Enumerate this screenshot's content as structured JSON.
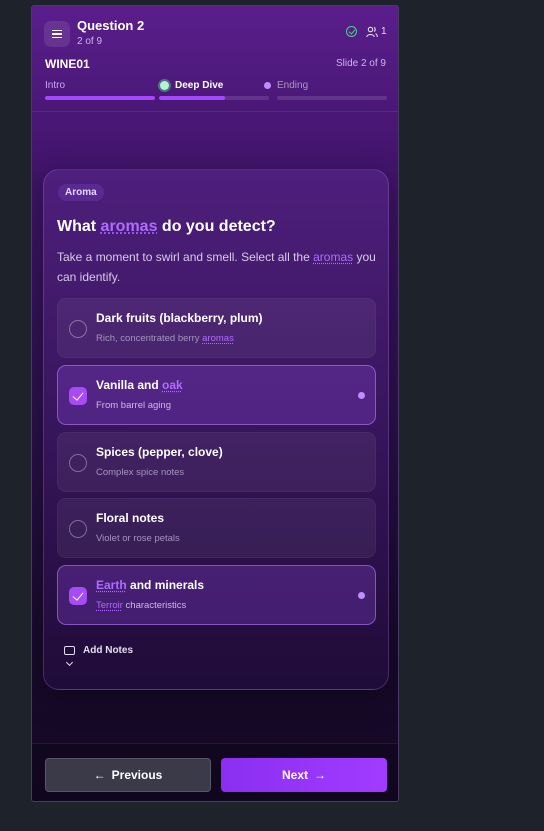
{
  "header": {
    "title": "Question 2",
    "progress_text": "2 of 9",
    "participants": "1",
    "session_code": "WINE01",
    "slide_info": "Slide 2 of 9",
    "steps": [
      {
        "label": "Intro",
        "progress": 1.0,
        "state": "done"
      },
      {
        "label": "Deep Dive",
        "progress": 0.6,
        "state": "current"
      },
      {
        "label": "Ending",
        "progress": 0.0,
        "state": "upcoming"
      }
    ]
  },
  "card": {
    "tag": "Aroma",
    "question_pre": "What ",
    "question_hl": "aromas",
    "question_post": " do you detect?",
    "desc_pre": "Take a moment to swirl and smell. Select all the ",
    "desc_hl": "aromas",
    "desc_post": " you can identify.",
    "options": [
      {
        "title_pre": "Dark fruits (blackberry, plum)",
        "title_hl": "",
        "title_post": "",
        "sub_pre": "Rich, concentrated berry ",
        "sub_hl": "aromas",
        "sub_post": "",
        "selected": false
      },
      {
        "title_pre": "Vanilla and ",
        "title_hl": "oak",
        "title_post": "",
        "sub_pre": "From barrel aging",
        "sub_hl": "",
        "sub_post": "",
        "selected": true
      },
      {
        "title_pre": "Spices (pepper, clove)",
        "title_hl": "",
        "title_post": "",
        "sub_pre": "Complex spice notes",
        "sub_hl": "",
        "sub_post": "",
        "selected": false
      },
      {
        "title_pre": "Floral notes",
        "title_hl": "",
        "title_post": "",
        "sub_pre": "Violet or rose petals",
        "sub_hl": "",
        "sub_post": "",
        "selected": false
      },
      {
        "title_pre": "",
        "title_hl": "Earth",
        "title_post": " and minerals",
        "sub_pre": "",
        "sub_hl": "Terroir",
        "sub_post": " characteristics",
        "selected": true
      }
    ],
    "notes_label": "Add Notes"
  },
  "footer": {
    "prev_label": "Previous",
    "next_label": "Next"
  },
  "colors": {
    "accent": "#a548ff",
    "success": "#4ad18a",
    "highlight": "#b06bff",
    "background": "#1e222b"
  },
  "icons": {
    "menu": "menu-icon",
    "status": "check-circle-icon",
    "users": "users-icon",
    "notes": "message-square-icon",
    "prev": "arrow-left-icon",
    "next": "arrow-right-icon"
  }
}
